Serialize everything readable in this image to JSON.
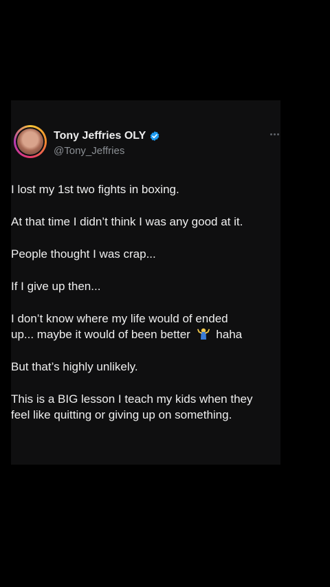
{
  "tweet": {
    "author": {
      "display_name": "Tony Jeffries OLY",
      "handle": "@Tony_Jeffries",
      "verified": true,
      "verified_color": "#1d9bf0",
      "avatar_icon": "profile-photo"
    },
    "more_icon": "ellipsis-icon",
    "paragraphs": [
      [
        "I lost my 1st two fights in boxing."
      ],
      [
        "At that time I didn’t think I was any good at it."
      ],
      [
        "People thought I was crap..."
      ],
      [
        "If I give up then..."
      ],
      [
        "I don’t know where my life would of ended",
        "up... maybe it would of been better",
        "haha"
      ],
      [
        "But that’s highly unlikely."
      ],
      [
        "This is a BIG lesson I teach my kids when they",
        "feel like quitting or giving up on something."
      ]
    ],
    "emoji": "person-shrugging-emoji"
  },
  "colors": {
    "background": "#000000",
    "card": "#0f0f10",
    "text": "#efefef",
    "muted": "#8b8f94"
  }
}
